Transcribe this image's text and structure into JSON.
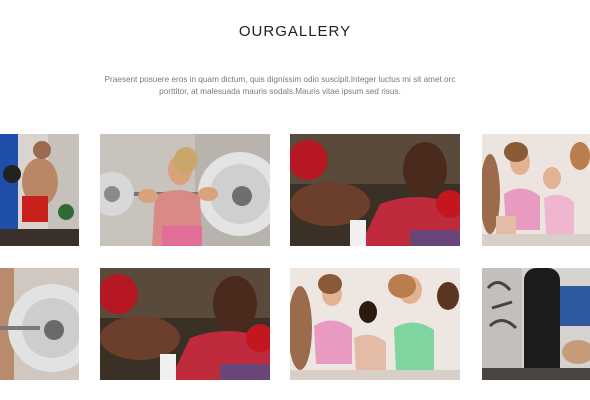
{
  "section": {
    "title": "OURGALLERY",
    "description": "Praesent posuere eros in quam dictum, quis dignissim odio suscipit.Integer luctus mi sit amet orc porttitor, at malesuada mauris sodals.Mauris vitae ipsum sed risus."
  },
  "gallery": {
    "rows": [
      [
        {
          "subject": "boxer-punching-bag-photo"
        },
        {
          "subject": "woman-lifting-barbell-photo"
        },
        {
          "subject": "boxer-gloves-photo"
        },
        {
          "subject": "spin-class-women-photo"
        }
      ],
      [
        {
          "subject": "barbell-plate-photo"
        },
        {
          "subject": "boxer-gloves-photo"
        },
        {
          "subject": "spin-class-women-photo"
        },
        {
          "subject": "punching-bag-graffiti-photo"
        }
      ]
    ]
  }
}
